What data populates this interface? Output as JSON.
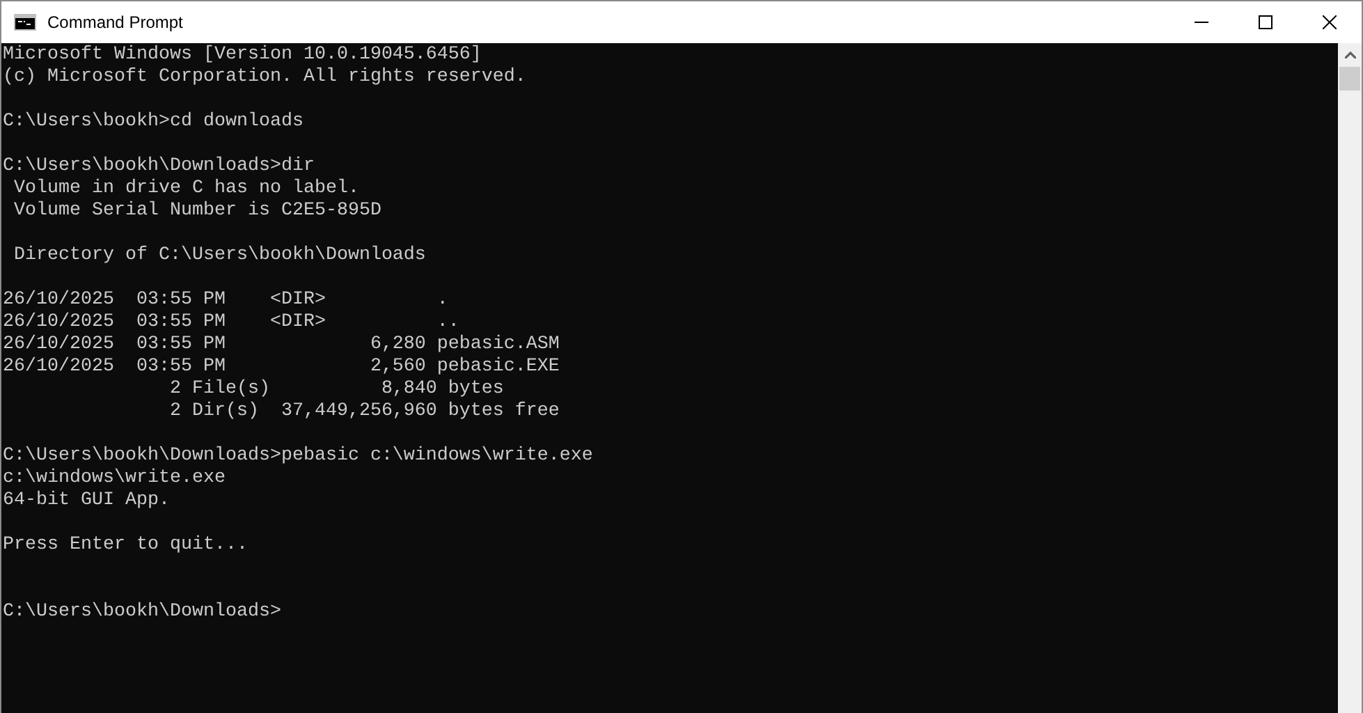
{
  "window": {
    "title": "Command Prompt"
  },
  "console": {
    "lines": [
      {
        "kind": "text",
        "text": "Microsoft Windows [Version 10.0.19045.6456]"
      },
      {
        "kind": "text",
        "text": "(c) Microsoft Corporation. All rights reserved."
      },
      {
        "kind": "blank"
      },
      {
        "kind": "text",
        "text": "C:\\Users\\bookh>cd downloads"
      },
      {
        "kind": "blank"
      },
      {
        "kind": "text",
        "text": "C:\\Users\\bookh\\Downloads>dir"
      },
      {
        "kind": "text",
        "text": " Volume in drive C has no label."
      },
      {
        "kind": "text",
        "text": " Volume Serial Number is C2E5-895D"
      },
      {
        "kind": "blank"
      },
      {
        "kind": "text",
        "text": " Directory of C:\\Users\\bookh\\Downloads"
      },
      {
        "kind": "blank"
      },
      {
        "kind": "text",
        "text": "26/10/2025  03:55 PM    <DIR>          ."
      },
      {
        "kind": "text",
        "text": "26/10/2025  03:55 PM    <DIR>          .."
      },
      {
        "kind": "text",
        "text": "26/10/2025  03:55 PM             6,280 pebasic.ASM"
      },
      {
        "kind": "text",
        "text": "26/10/2025  03:55 PM             2,560 pebasic.EXE"
      },
      {
        "kind": "text",
        "text": "               2 File(s)          8,840 bytes"
      },
      {
        "kind": "text",
        "text": "               2 Dir(s)  37,449,256,960 bytes free"
      },
      {
        "kind": "blank"
      },
      {
        "kind": "text",
        "text": "C:\\Users\\bookh\\Downloads>pebasic c:\\windows\\write.exe"
      },
      {
        "kind": "text",
        "text": "c:\\windows\\write.exe"
      },
      {
        "kind": "text",
        "text": "64-bit GUI App."
      },
      {
        "kind": "blank"
      },
      {
        "kind": "text",
        "text": "Press Enter to quit..."
      },
      {
        "kind": "blank"
      },
      {
        "kind": "blank"
      },
      {
        "kind": "text",
        "text": "C:\\Users\\bookh\\Downloads>"
      }
    ]
  }
}
